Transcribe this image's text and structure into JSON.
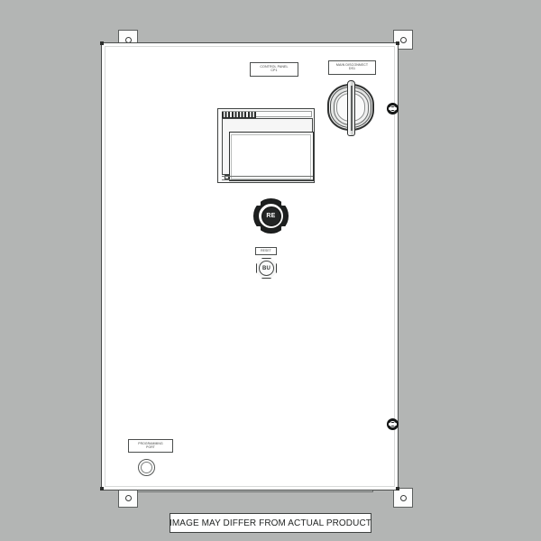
{
  "caption": {
    "text": "IMAGE MAY DIFFER FROM ACTUAL PRODUCT"
  },
  "enclosure": {
    "name": "control-panel-enclosure",
    "door_color": "#ffffff",
    "outline_color": "#4a4d4c",
    "background_color": "#b3b5b4"
  },
  "nameplates": [
    {
      "id": "control-panel",
      "line1": "CONTROL PANEL",
      "line2": "CP1"
    },
    {
      "id": "main-disconnect",
      "line1": "MAIN DISCONNECT",
      "line2": "DS1"
    },
    {
      "id": "reset",
      "line1": "RESET",
      "line2": ""
    },
    {
      "id": "programming-port",
      "line1": "PROGRAMMING",
      "line2": "PORT"
    }
  ],
  "controls": {
    "disconnect_handle": {
      "label": "MAIN DISCONNECT",
      "tag": "DS1",
      "type": "rotary-disconnect-handle",
      "position": "OFF",
      "body_color": "#2f3130"
    },
    "hmi": {
      "type": "touchscreen-hmi",
      "screen_color": "#ffffff",
      "bezel_color": "#f6f6f6"
    },
    "selector": {
      "text": "RE",
      "type": "selector-switch",
      "cap_color": "#232525"
    },
    "reset_button": {
      "text": "BU",
      "type": "push-button",
      "body_color": "#f7f7f7"
    },
    "programming_port": {
      "type": "circular-port"
    }
  },
  "hardware": {
    "latches": [
      {
        "id": "latch-top",
        "type": "quarter-turn-latch"
      },
      {
        "id": "latch-bottom",
        "type": "quarter-turn-latch"
      }
    ],
    "brackets": [
      {
        "id": "bracket-top-left"
      },
      {
        "id": "bracket-top-right"
      },
      {
        "id": "bracket-bottom-left"
      },
      {
        "id": "bracket-bottom-right"
      }
    ]
  }
}
